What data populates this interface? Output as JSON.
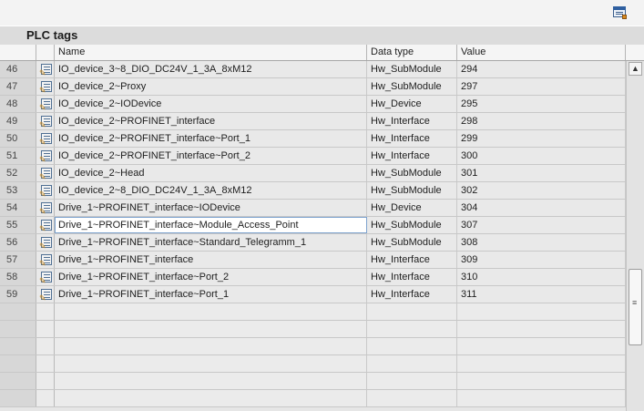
{
  "panel": {
    "title": "PLC tags"
  },
  "columns": {
    "name": "Name",
    "data_type": "Data type",
    "value": "Value"
  },
  "rows": [
    {
      "num": "46",
      "name": "IO_device_3~8_DIO_DC24V_1_3A_8xM12",
      "type": "Hw_SubModule",
      "value": "294"
    },
    {
      "num": "47",
      "name": "IO_device_2~Proxy",
      "type": "Hw_SubModule",
      "value": "297"
    },
    {
      "num": "48",
      "name": "IO_device_2~IODevice",
      "type": "Hw_Device",
      "value": "295"
    },
    {
      "num": "49",
      "name": "IO_device_2~PROFINET_interface",
      "type": "Hw_Interface",
      "value": "298"
    },
    {
      "num": "50",
      "name": "IO_device_2~PROFINET_interface~Port_1",
      "type": "Hw_Interface",
      "value": "299"
    },
    {
      "num": "51",
      "name": "IO_device_2~PROFINET_interface~Port_2",
      "type": "Hw_Interface",
      "value": "300"
    },
    {
      "num": "52",
      "name": "IO_device_2~Head",
      "type": "Hw_SubModule",
      "value": "301"
    },
    {
      "num": "53",
      "name": "IO_device_2~8_DIO_DC24V_1_3A_8xM12",
      "type": "Hw_SubModule",
      "value": "302"
    },
    {
      "num": "54",
      "name": "Drive_1~PROFINET_interface~IODevice",
      "type": "Hw_Device",
      "value": "304"
    },
    {
      "num": "55",
      "name": "Drive_1~PROFINET_interface~Module_Access_Point",
      "type": "Hw_SubModule",
      "value": "307"
    },
    {
      "num": "56",
      "name": "Drive_1~PROFINET_interface~Standard_Telegramm_1",
      "type": "Hw_SubModule",
      "value": "308"
    },
    {
      "num": "57",
      "name": "Drive_1~PROFINET_interface",
      "type": "Hw_Interface",
      "value": "309"
    },
    {
      "num": "58",
      "name": "Drive_1~PROFINET_interface~Port_2",
      "type": "Hw_Interface",
      "value": "310"
    },
    {
      "num": "59",
      "name": "Drive_1~PROFINET_interface~Port_1",
      "type": "Hw_Interface",
      "value": "311"
    }
  ],
  "selected_row": "55",
  "icons": {
    "tag_row": "plc-tag-icon",
    "corner": "window-options-icon",
    "scroll_up": "chevron-up-icon",
    "scroll_grip": "grip-icon"
  },
  "scroll_up_glyph": "▲",
  "grip_glyph": "≡"
}
